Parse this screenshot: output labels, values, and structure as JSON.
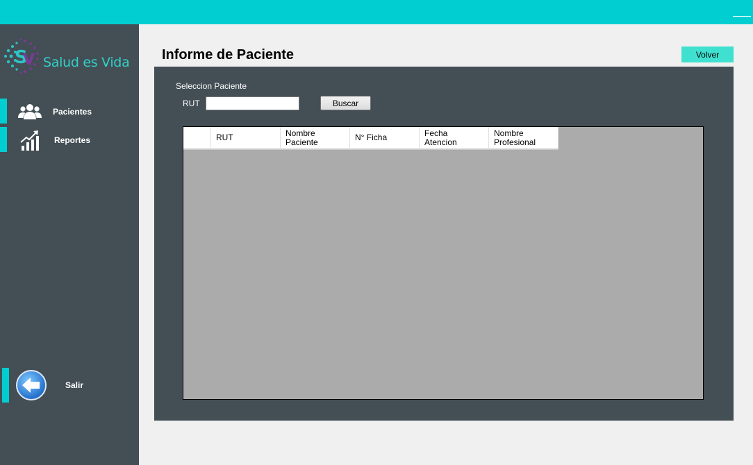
{
  "app": {
    "accent_color": "#00ced1",
    "sidebar_color": "#434e55",
    "window_controls": [
      "minimize-icon"
    ]
  },
  "sidebar": {
    "logo_text": "Salud es Vida",
    "items": [
      {
        "label": "Pacientes",
        "icon": "users-icon"
      },
      {
        "label": "Reportes",
        "icon": "chart-growth-icon"
      },
      {
        "label": "Salir",
        "icon": "back-arrow-icon"
      }
    ]
  },
  "main": {
    "title": "Informe de Paciente",
    "back_button": "Volver"
  },
  "search": {
    "section_label": "Seleccion Paciente",
    "rut_label": "RUT",
    "rut_value": "",
    "button_label": "Buscar"
  },
  "table": {
    "columns": [
      "RUT",
      "Nombre\nPaciente",
      "N° Ficha",
      "Fecha\nAtencion",
      "Nombre\nProfesional"
    ],
    "rows": []
  }
}
